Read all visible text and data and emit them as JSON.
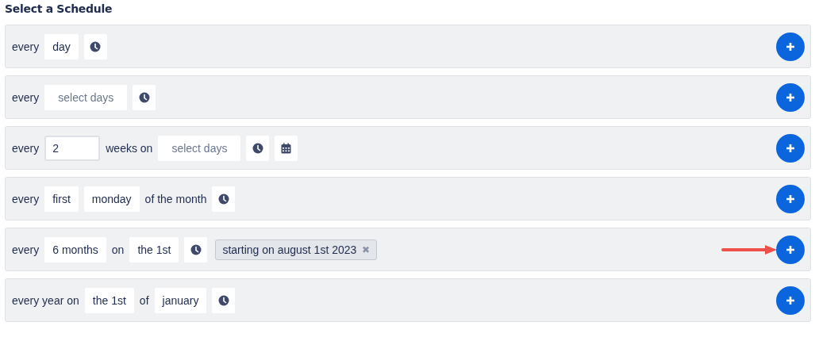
{
  "title": "Select a Schedule",
  "rows": [
    {
      "pointer": false,
      "parts": [
        {
          "kind": "text",
          "text": "every"
        },
        {
          "kind": "select",
          "value": "day"
        },
        {
          "kind": "clock"
        }
      ]
    },
    {
      "pointer": false,
      "parts": [
        {
          "kind": "text",
          "text": "every"
        },
        {
          "kind": "select",
          "placeholder": "select days"
        },
        {
          "kind": "clock"
        }
      ]
    },
    {
      "pointer": false,
      "parts": [
        {
          "kind": "text",
          "text": "every"
        },
        {
          "kind": "input",
          "value": "2"
        },
        {
          "kind": "text",
          "text": "weeks on"
        },
        {
          "kind": "select",
          "placeholder": "select days"
        },
        {
          "kind": "clock"
        },
        {
          "kind": "calendar"
        }
      ]
    },
    {
      "pointer": false,
      "parts": [
        {
          "kind": "text",
          "text": "every"
        },
        {
          "kind": "select",
          "value": "first"
        },
        {
          "kind": "select",
          "value": "monday"
        },
        {
          "kind": "text",
          "text": "of the month"
        },
        {
          "kind": "clock"
        }
      ]
    },
    {
      "pointer": true,
      "parts": [
        {
          "kind": "text",
          "text": "every"
        },
        {
          "kind": "select",
          "value": "6 months"
        },
        {
          "kind": "text",
          "text": "on"
        },
        {
          "kind": "select",
          "value": "the 1st"
        },
        {
          "kind": "clock"
        },
        {
          "kind": "tag",
          "text": "starting on august 1st 2023",
          "close": "✖"
        }
      ]
    },
    {
      "pointer": false,
      "parts": [
        {
          "kind": "text",
          "text": "every year on"
        },
        {
          "kind": "select",
          "value": "the 1st"
        },
        {
          "kind": "text",
          "text": "of"
        },
        {
          "kind": "select",
          "value": "january"
        },
        {
          "kind": "clock"
        }
      ]
    }
  ]
}
